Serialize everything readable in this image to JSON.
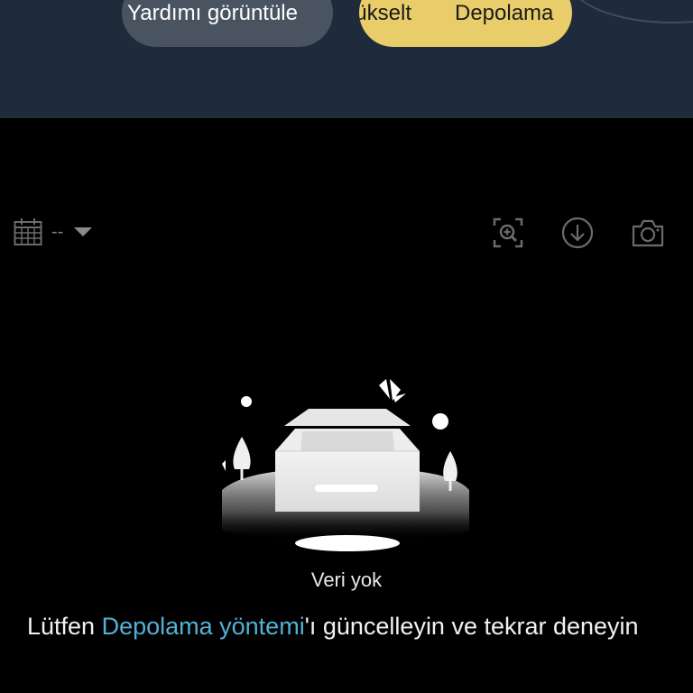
{
  "header": {
    "help_button_label": "Yardımı görüntüle",
    "upgrade_button_label": "Yükselt",
    "storage_button_label": "Depolama"
  },
  "toolbar": {
    "date_value": "--",
    "icons": [
      "calendar-icon",
      "dropdown-caret-icon",
      "zoom-in-icon",
      "download-icon",
      "camera-icon"
    ]
  },
  "empty_state": {
    "label": "Veri yok",
    "message_prefix": "Lütfen ",
    "message_link": "Depolama yöntemi",
    "message_suffix": "'ı güncelleyin ve tekrar deneyin"
  },
  "colors": {
    "header_bg": "#1f2b3a",
    "help_pill": "#4a5461",
    "upgrade_pill": "#e8cd6a",
    "link": "#52b2d6",
    "page_bg": "#000000"
  }
}
